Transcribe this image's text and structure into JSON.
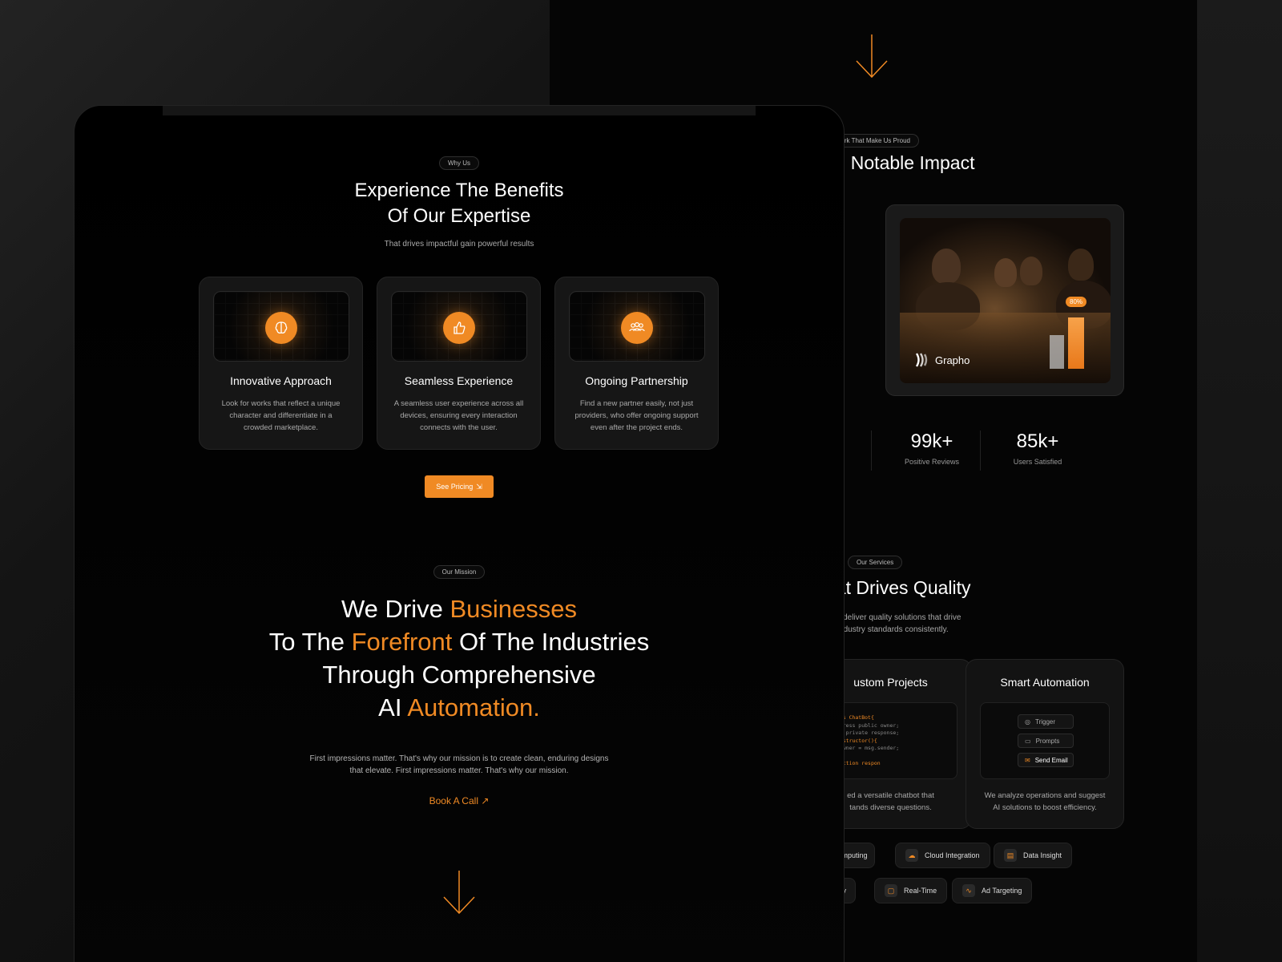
{
  "colors": {
    "accent": "#f08a24",
    "background": "#000000",
    "card": "#161616"
  },
  "front": {
    "why_pill": "Why Us",
    "heading_line1": "Experience The Benefits",
    "heading_line2": "Of Our Expertise",
    "subheading": "That drives impactful gain powerful results",
    "cards": [
      {
        "icon": "brain-icon",
        "title": "Innovative Approach",
        "desc": "Look for works that reflect a unique character and differentiate in a crowded marketplace."
      },
      {
        "icon": "thumbs-up-icon",
        "title": "Seamless Experience",
        "desc": "A seamless user experience across all devices, ensuring every interaction connects with the user."
      },
      {
        "icon": "team-icon",
        "title": "Ongoing Partnership",
        "desc": "Find a new partner easily, not just providers, who offer ongoing support even after the project ends."
      }
    ],
    "pricing_button": "See Pricing",
    "mission_pill": "Our Mission",
    "mission": {
      "l1a": "We Drive ",
      "l1b": "Businesses",
      "l2a": "To The ",
      "l2b": "Forefront",
      "l2c": " Of The Industries",
      "l3": "Through Comprehensive",
      "l4a": "AI ",
      "l4b": "Automation."
    },
    "mission_paragraph": "First impressions matter. That's why our mission is to create clean, enduring designs that elevate. First impressions matter. That's why our mission.",
    "book_call": "Book A Call"
  },
  "back": {
    "work_pill": "Work That Make Us Proud",
    "works_heading": "ks, Notable Impact",
    "showcase": {
      "brand": "Grapho",
      "percent": "80%"
    },
    "stats": [
      {
        "value": "99k+",
        "label": "Positive Reviews"
      },
      {
        "value": "85k+",
        "label": "Users Satisfied"
      }
    ],
    "services_pill": "Our Services",
    "services_heading": "hat Drives Quality",
    "services_desc_1": ", we deliver quality solutions that drive",
    "services_desc_2": "ed industry standards consistently.",
    "service_cards": [
      {
        "title": "ustom Projects",
        "desc_1": "ed a versatile chatbot that",
        "desc_2": "tands diverse questions."
      },
      {
        "title": "Smart Automation",
        "desc_1": "We analyze operations and suggest",
        "desc_2": "AI solutions to boost efficiency."
      }
    ],
    "code_lines": [
      "lass ChatBot{",
      "address public owner;",
      "int private response;",
      "constructor(){",
      "  owner = msg.sender;",
      "}",
      "function respon"
    ],
    "automation_items": [
      "Trigger",
      "Prompts",
      "Send Email"
    ],
    "chips_row1": [
      "Computing",
      "Cloud Integration",
      "Data Insight"
    ],
    "chips_row2": [
      "urity",
      "Real-Time",
      "Ad Targeting"
    ]
  }
}
